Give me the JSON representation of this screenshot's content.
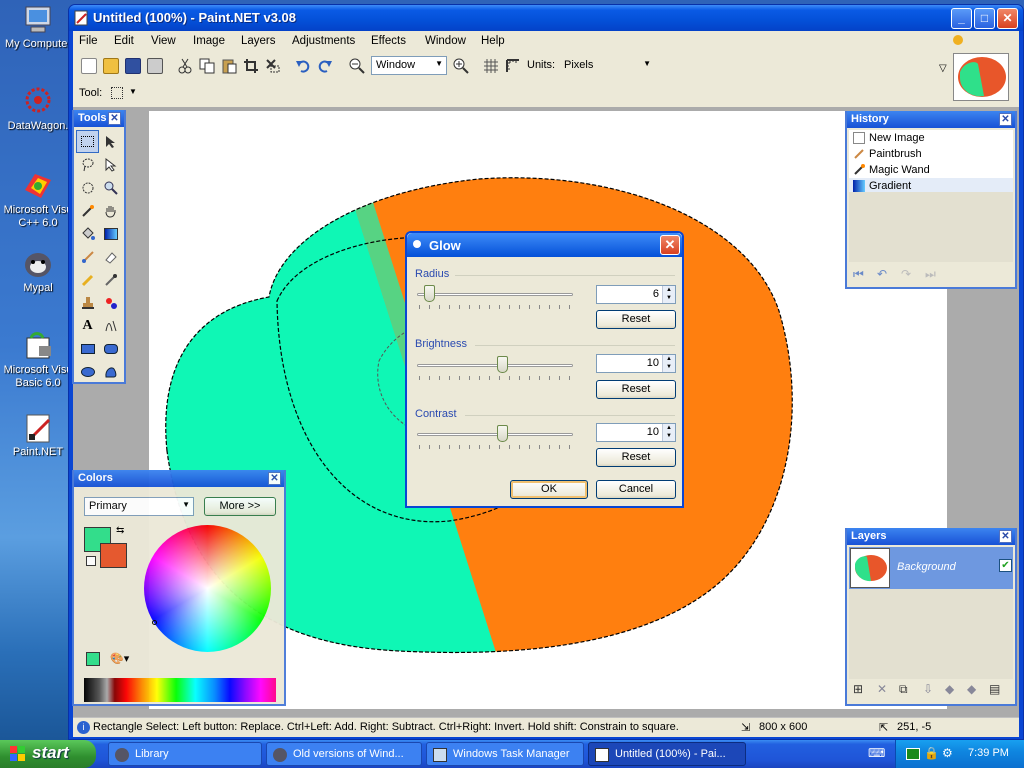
{
  "desktop": {
    "icons": [
      {
        "label": "My Computer",
        "icon": "my-computer-icon"
      },
      {
        "label": "DataWagon.",
        "icon": "datawagon-icon"
      },
      {
        "label": "Microsoft Visu C++ 6.0",
        "icon": "msvc-icon"
      },
      {
        "label": "Mypal",
        "icon": "mypal-icon"
      },
      {
        "label": "Microsoft Visu Basic 6.0",
        "icon": "vb6-icon"
      },
      {
        "label": "Paint.NET",
        "icon": "paintnet-icon"
      }
    ]
  },
  "window": {
    "title": "Untitled (100%) - Paint.NET v3.08",
    "controls": {
      "minimize": "_",
      "maximize": "□",
      "close": "✕"
    }
  },
  "menu": [
    "File",
    "Edit",
    "View",
    "Image",
    "Layers",
    "Adjustments",
    "Effects",
    "Window",
    "Help"
  ],
  "toolbar": {
    "zoom_value": "Window",
    "units_label": "Units:",
    "units_value": "Pixels",
    "tool_label": "Tool:"
  },
  "tools_panel": {
    "title": "Tools",
    "tools": [
      "rectangle-select",
      "move-selection",
      "lasso-select",
      "move-selected",
      "ellipse-select",
      "zoom",
      "magic-wand",
      "pan",
      "paint-bucket",
      "gradient",
      "paintbrush",
      "eraser",
      "pencil",
      "color-picker",
      "clone-stamp",
      "recolor",
      "text",
      "line-curve",
      "rectangle",
      "rounded-rectangle",
      "ellipse",
      "freeform-shape"
    ]
  },
  "history_panel": {
    "title": "History",
    "items": [
      {
        "label": "New Image",
        "icon": "new-image-icon"
      },
      {
        "label": "Paintbrush",
        "icon": "paintbrush-icon"
      },
      {
        "label": "Magic Wand",
        "icon": "magic-wand-icon"
      },
      {
        "label": "Gradient",
        "icon": "gradient-icon"
      }
    ]
  },
  "colors_panel": {
    "title": "Colors",
    "select_value": "Primary",
    "more_label": "More >>",
    "primary_color": "#2fe08a",
    "secondary_color": "#e8562a"
  },
  "layers_panel": {
    "title": "Layers",
    "layer_name": "Background",
    "layer_visible": true
  },
  "glow_dialog": {
    "title": "Glow",
    "radius_label": "Radius",
    "radius_value": "6",
    "brightness_label": "Brightness",
    "brightness_value": "10",
    "contrast_label": "Contrast",
    "contrast_value": "10",
    "reset_label": "Reset",
    "ok_label": "OK",
    "cancel_label": "Cancel"
  },
  "statusbar": {
    "hint": "Rectangle Select: Left button: Replace. Ctrl+Left: Add. Right: Subtract. Ctrl+Right: Invert. Hold shift: Constrain to square.",
    "image_size": "800 x 600",
    "cursor_pos": "251, -5"
  },
  "taskbar": {
    "start_label": "start",
    "tasks": [
      {
        "label": "Library",
        "active": false
      },
      {
        "label": "Old versions of Wind...",
        "active": false
      },
      {
        "label": "Windows Task Manager",
        "active": false
      },
      {
        "label": "Untitled (100%) - Pai...",
        "active": true
      }
    ],
    "clock": "7:39 PM"
  },
  "colors": {
    "teal": "#0ff7b5",
    "orange": "#ff7f0f",
    "xp_blue": "#0a46d3"
  }
}
